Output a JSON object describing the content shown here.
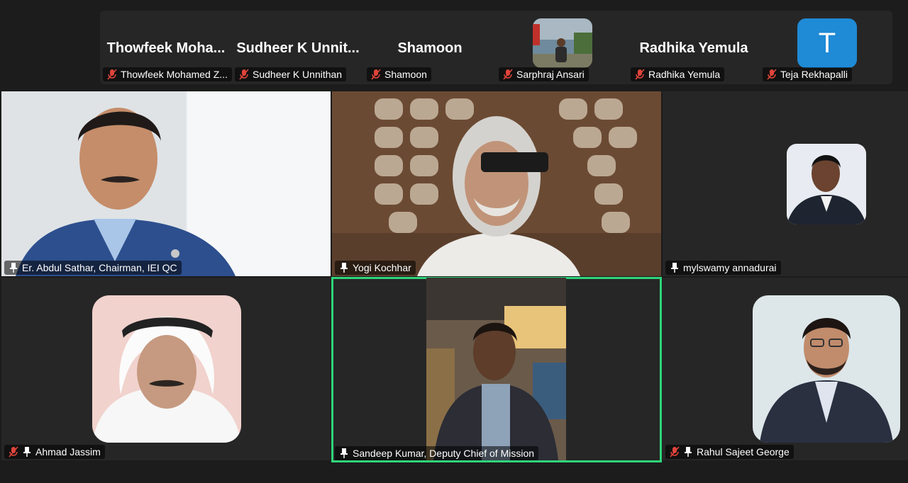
{
  "strip": {
    "thumbs": [
      {
        "display": "Thowfeek  Moha...",
        "label": "Thowfeek Mohamed Z..."
      },
      {
        "display": "Sudheer  K  Unnit...",
        "label": "Sudheer K Unnithan"
      },
      {
        "display": "Shamoon",
        "label": "Shamoon"
      },
      {
        "display": "",
        "label": "Sarphraj Ansari"
      },
      {
        "display": "Radhika Yemula",
        "label": "Radhika Yemula"
      },
      {
        "display": "T",
        "label": "Teja Rekhapalli"
      }
    ]
  },
  "tiles": [
    {
      "label": "Er. Abdul Sathar, Chairman, IEI QC"
    },
    {
      "label": "Yogi Kochhar"
    },
    {
      "label": "mylswamy annadurai"
    },
    {
      "label": "Ahmad Jassim"
    },
    {
      "label": "Sandeep Kumar, Deputy Chief of Mission"
    },
    {
      "label": "Rahul Sajeet George"
    }
  ],
  "colors": {
    "active_border": "#2fd57a",
    "avatar_blue": "#1f8ad6",
    "mic_muted": "#e0443a"
  }
}
